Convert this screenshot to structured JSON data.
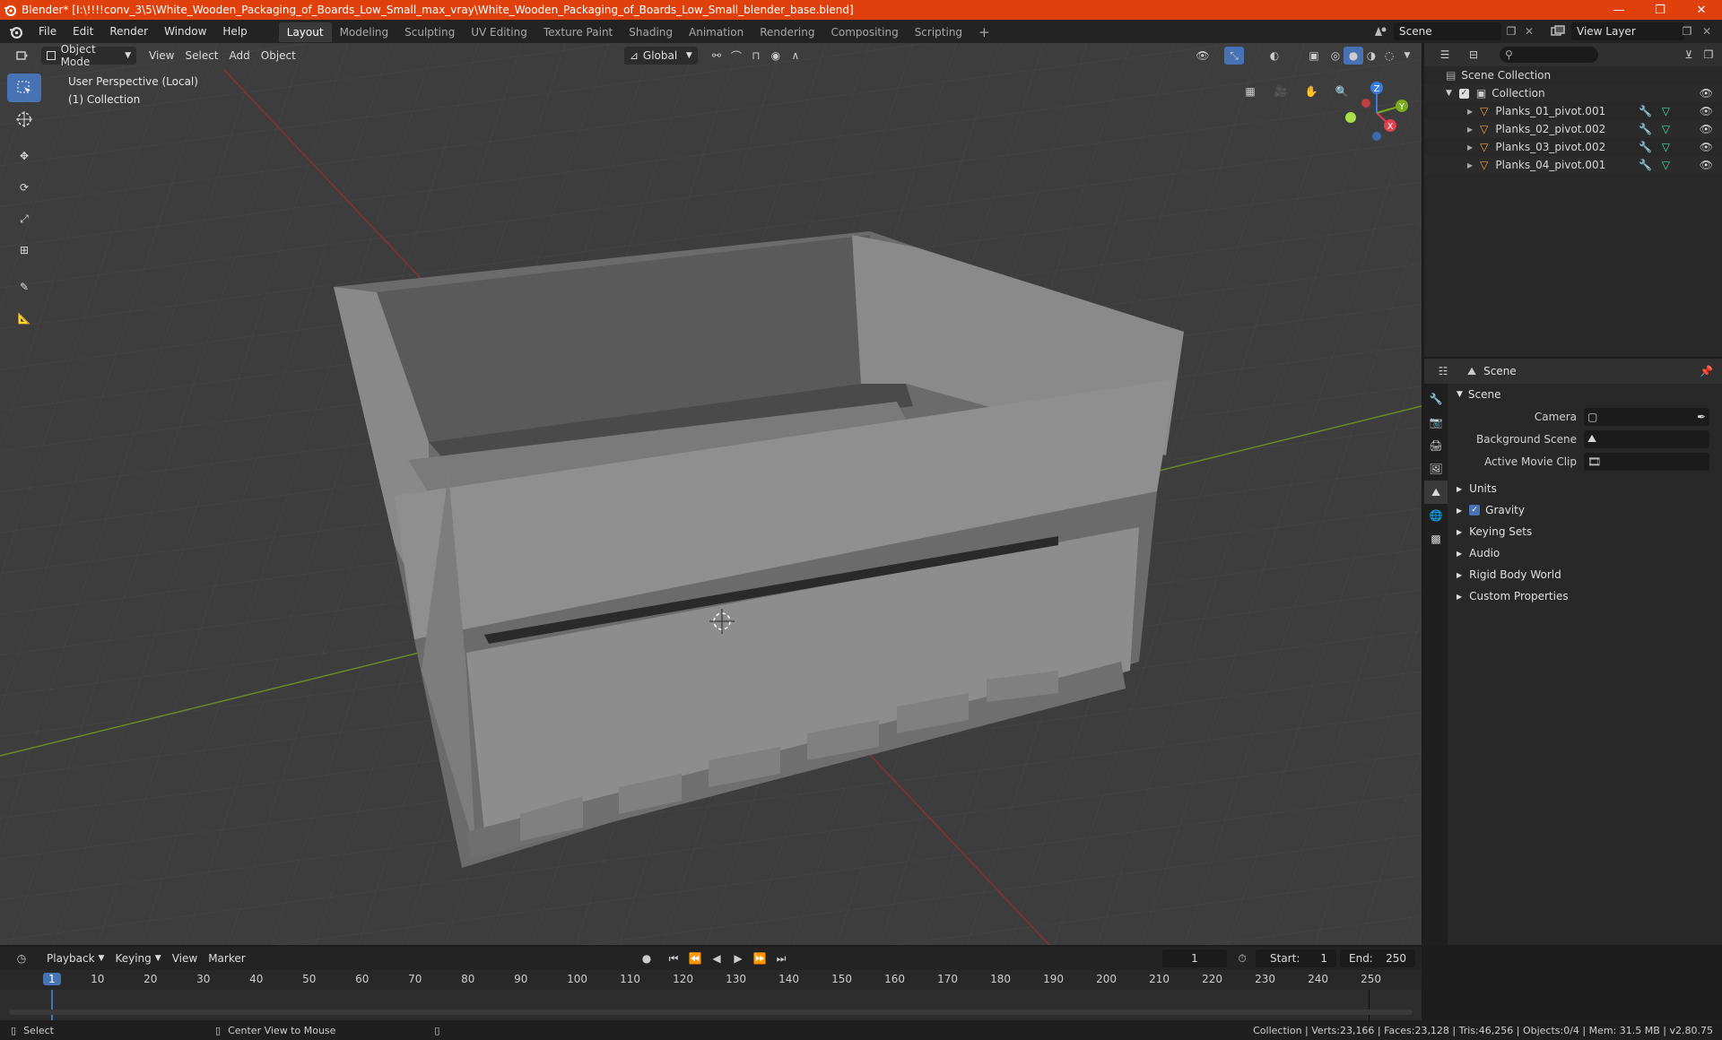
{
  "window": {
    "title": "Blender* [I:\\!!!!conv_3\\5\\White_Wooden_Packaging_of_Boards_Low_Small_max_vray\\White_Wooden_Packaging_of_Boards_Low_Small_blender_base.blend]",
    "minimize": "—",
    "maximize": "❐",
    "close": "✕"
  },
  "menus": [
    "File",
    "Edit",
    "Render",
    "Window",
    "Help"
  ],
  "workspaces": [
    "Layout",
    "Modeling",
    "Sculpting",
    "UV Editing",
    "Texture Paint",
    "Shading",
    "Animation",
    "Rendering",
    "Compositing",
    "Scripting"
  ],
  "active_workspace": "Layout",
  "add_workspace": "+",
  "scene_name": "Scene",
  "view_layer": "View Layer",
  "viewport": {
    "mode": "Object Mode",
    "menus": [
      "View",
      "Select",
      "Add",
      "Object"
    ],
    "orientation": "Global",
    "overlay_line1": "User Perspective (Local)",
    "overlay_line2": "(1) Collection",
    "gizmo": {
      "z": "Z",
      "y": "Y",
      "x": "X"
    }
  },
  "outliner": {
    "root": "Scene Collection",
    "collection": "Collection",
    "objects": [
      "Planks_01_pivot.001",
      "Planks_02_pivot.002",
      "Planks_03_pivot.002",
      "Planks_04_pivot.001"
    ]
  },
  "properties": {
    "header": "Scene",
    "panel": "Scene",
    "rows": [
      {
        "label": "Camera"
      },
      {
        "label": "Background Scene"
      },
      {
        "label": "Active Movie Clip"
      }
    ],
    "sections": [
      "Units",
      "Gravity",
      "Keying Sets",
      "Audio",
      "Rigid Body World",
      "Custom Properties"
    ],
    "gravity_checked": true
  },
  "timeline": {
    "menus": [
      "Playback",
      "Keying",
      "View",
      "Marker"
    ],
    "current_frame": "1",
    "start_label": "Start:",
    "start": "1",
    "end_label": "End:",
    "end": "250",
    "ruler": [
      "1",
      "10",
      "20",
      "30",
      "40",
      "50",
      "60",
      "70",
      "80",
      "90",
      "100",
      "110",
      "120",
      "130",
      "140",
      "150",
      "160",
      "170",
      "180",
      "190",
      "200",
      "210",
      "220",
      "230",
      "240",
      "250"
    ]
  },
  "status": {
    "select": "Select",
    "center": "Center View to Mouse",
    "stats": "Collection | Verts:23,166 | Faces:23,128 | Tris:46,256 | Objects:0/4 | Mem: 31.5 MB | v2.80.75"
  }
}
